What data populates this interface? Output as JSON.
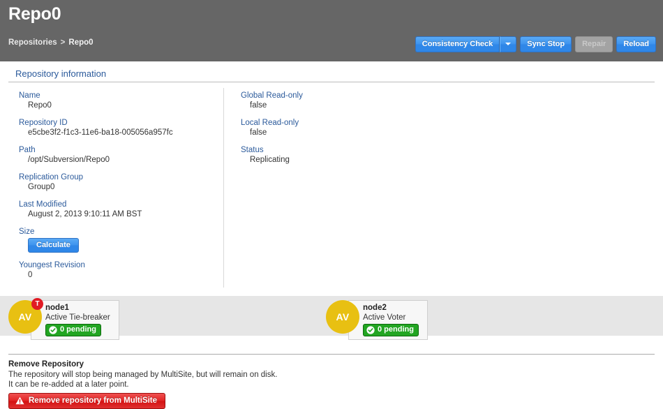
{
  "header": {
    "title": "Repo0",
    "breadcrumb": {
      "root": "Repositories",
      "separator": ">",
      "current": "Repo0"
    },
    "actions": {
      "consistency_check": "Consistency Check",
      "consistency_check_caret": "chevron-down-icon",
      "sync_stop": "Sync Stop",
      "repair": "Repair",
      "reload": "Reload"
    },
    "colors": {
      "background": "#666666",
      "button_blue": "#2f87e8",
      "button_disabled": "#a3a3a3"
    }
  },
  "info_section": {
    "title": "Repository information",
    "left_fields": [
      {
        "label": "Name",
        "value": "Repo0"
      },
      {
        "label": "Repository ID",
        "value": "e5cbe3f2-f1c3-11e6-ba18-005056a957fc"
      },
      {
        "label": "Path",
        "value": "/opt/Subversion/Repo0"
      },
      {
        "label": "Replication Group",
        "value": "Group0"
      },
      {
        "label": "Last Modified",
        "value": "August 2, 2013 9:10:11 AM BST"
      }
    ],
    "size_field": {
      "label": "Size",
      "button_label": "Calculate"
    },
    "youngest_revision": {
      "label": "Youngest Revision",
      "value": "0"
    },
    "right_fields": [
      {
        "label": "Global Read-only",
        "value": "false"
      },
      {
        "label": "Local Read-only",
        "value": "false"
      },
      {
        "label": "Status",
        "value": "Replicating"
      }
    ],
    "label_color": "#2b5a9b"
  },
  "nodes": [
    {
      "avatar_text": "AV",
      "avatar_color": "#e8c012",
      "tie_breaker_badge": "T",
      "tie_breaker_badge_color": "#e01b24",
      "name": "node1",
      "role": "Active Tie-breaker",
      "pending_label": "0 pending",
      "pending_icon": "circle-check-icon",
      "pending_color": "#22a522"
    },
    {
      "avatar_text": "AV",
      "avatar_color": "#e8c012",
      "tie_breaker_badge": "",
      "name": "node2",
      "role": "Active Voter",
      "pending_label": "0 pending",
      "pending_icon": "circle-check-icon",
      "pending_color": "#22a522"
    }
  ],
  "remove_section": {
    "title": "Remove Repository",
    "description_line1": "The repository will stop being managed by MultiSite, but will remain on disk.",
    "description_line2": "It can be re-added at a later point.",
    "button_label": "Remove repository from MultiSite",
    "button_icon": "warning-triangle-icon",
    "button_color": "#e22424"
  }
}
